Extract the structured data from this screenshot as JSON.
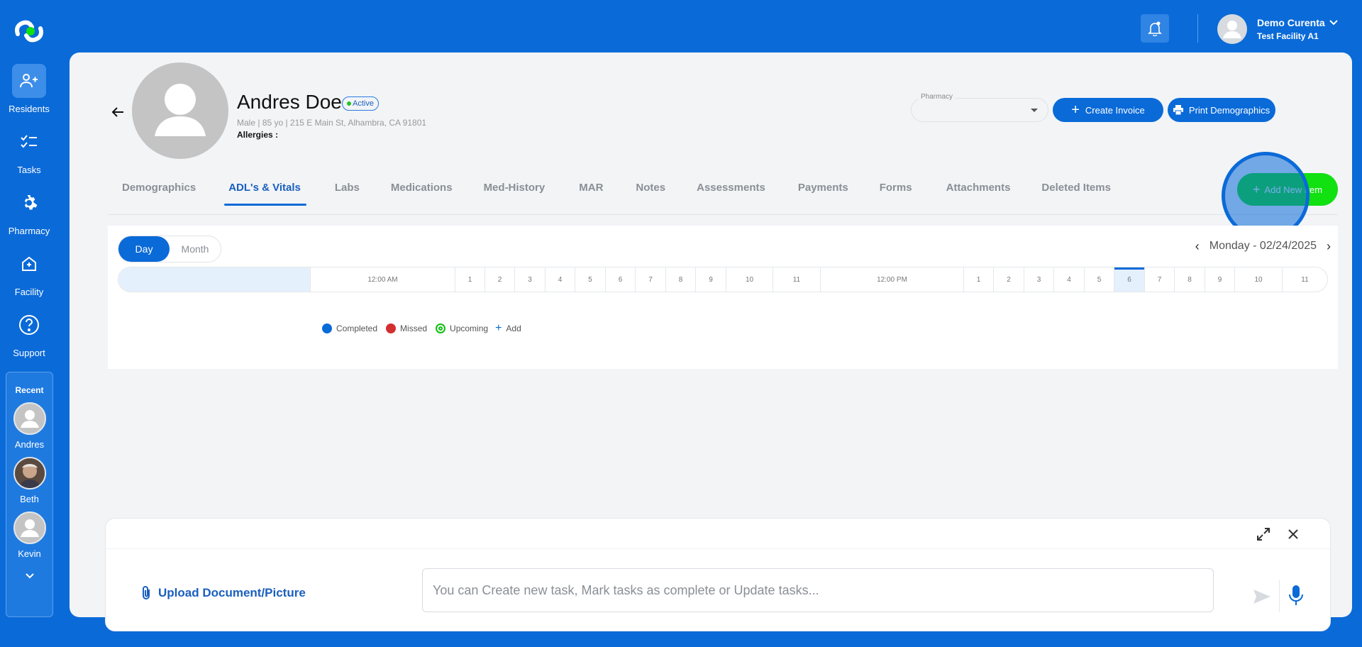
{
  "nav": {
    "items": [
      {
        "label": "Residents",
        "icon": "residents-icon"
      },
      {
        "label": "Tasks",
        "icon": "tasks-icon"
      },
      {
        "label": "Pharmacy",
        "icon": "gear-icon"
      },
      {
        "label": "Facility",
        "icon": "facility-icon"
      },
      {
        "label": "Support",
        "icon": "help-icon"
      }
    ],
    "recent": {
      "title": "Recent",
      "items": [
        {
          "name": "Andres"
        },
        {
          "name": "Beth"
        },
        {
          "name": "Kevin"
        }
      ]
    }
  },
  "header": {
    "user_name": "Demo Curenta",
    "facility": "Test Facility A1"
  },
  "resident": {
    "name": "Andres Doe",
    "status": "Active",
    "meta": "Male | 85 yo | 215 E Main St, Alhambra, CA 91801",
    "allergies_label": "Allergies :"
  },
  "actions": {
    "pharmacy_label": "Pharmacy",
    "create_invoice": "Create Invoice",
    "print_demographics": "Print Demographics",
    "add_new_item": "Add New Item"
  },
  "tabs": [
    {
      "label": "Demographics"
    },
    {
      "label": "ADL's & Vitals"
    },
    {
      "label": "Labs"
    },
    {
      "label": "Medications"
    },
    {
      "label": "Med-History"
    },
    {
      "label": "MAR"
    },
    {
      "label": "Notes"
    },
    {
      "label": "Assessments"
    },
    {
      "label": "Payments"
    },
    {
      "label": "Forms"
    },
    {
      "label": "Attachments"
    },
    {
      "label": "Deleted Items"
    }
  ],
  "schedule": {
    "view_day": "Day",
    "view_month": "Month",
    "date": "Monday - 02/24/2025",
    "hours": [
      "12:00 AM",
      "1",
      "2",
      "3",
      "4",
      "5",
      "6",
      "7",
      "8",
      "9",
      "10",
      "11",
      "12:00 PM",
      "1",
      "2",
      "3",
      "4",
      "5",
      "6",
      "7",
      "8",
      "9",
      "10",
      "11"
    ],
    "legend": {
      "completed": "Completed",
      "missed": "Missed",
      "upcoming": "Upcoming",
      "add": "Add"
    }
  },
  "chat": {
    "upload_label": "Upload Document/Picture",
    "input_placeholder": "You can Create new task, Mark tasks as complete or Update tasks..."
  },
  "colors": {
    "primary": "#0a6ad8",
    "success": "#11e011",
    "missed": "#d32f2f"
  }
}
